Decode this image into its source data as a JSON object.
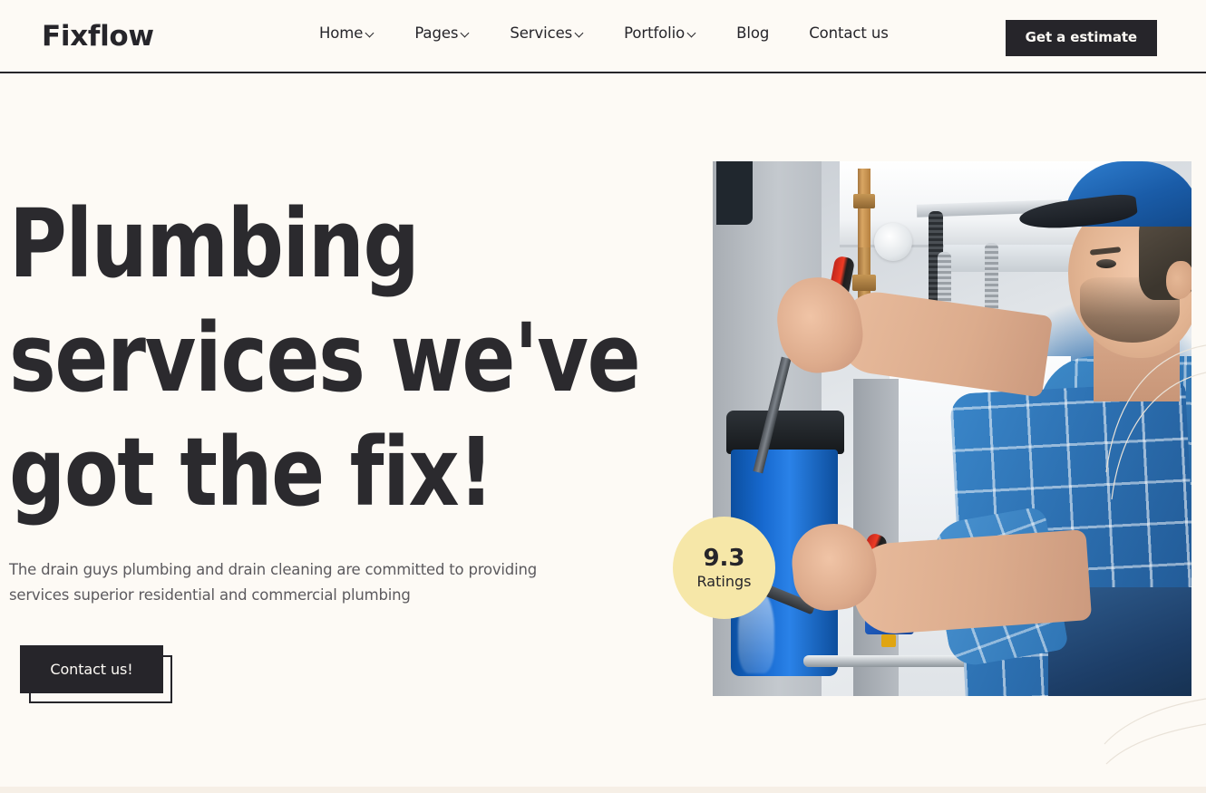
{
  "header": {
    "brand": "Fixflow",
    "nav": [
      {
        "label": "Home",
        "has_dropdown": true
      },
      {
        "label": "Pages",
        "has_dropdown": true
      },
      {
        "label": "Services",
        "has_dropdown": true
      },
      {
        "label": "Portfolio",
        "has_dropdown": true
      },
      {
        "label": "Blog",
        "has_dropdown": false
      },
      {
        "label": "Contact us",
        "has_dropdown": false
      }
    ],
    "cta_label": "Get a estimate"
  },
  "hero": {
    "title": "Plumbing\nservices we've\ngot the fix!",
    "subtitle": "The drain guys plumbing and drain cleaning are committed to providing\nservices superior residential and commercial plumbing",
    "button_label": "Contact us!",
    "image_alt": "plumber-working-on-pipes-photo",
    "badge": {
      "score": "9.3",
      "label": "Ratings"
    }
  },
  "colors": {
    "background": "#fdfaf5",
    "text_dark": "#26252a",
    "text_muted": "#5c5a5e",
    "badge_yellow": "#f6e7a8",
    "button_dark": "#26252a",
    "divider": "#f6efe6"
  }
}
